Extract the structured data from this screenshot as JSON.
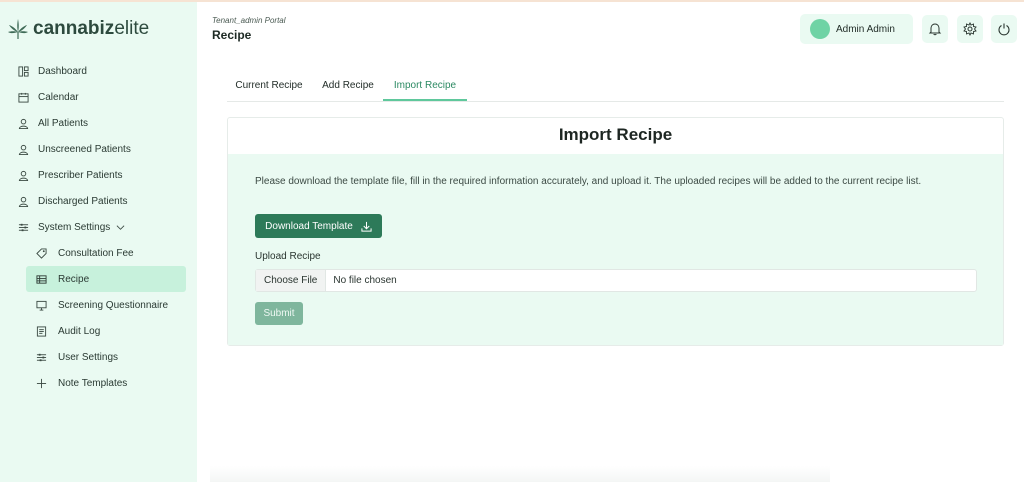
{
  "brand": {
    "name_bold": "cannabiz",
    "name_light": "elite"
  },
  "header": {
    "portal": "Tenant_admin Portal",
    "title": "Recipe"
  },
  "user": {
    "name": "Admin Admin"
  },
  "sidebar": {
    "items": [
      {
        "label": "Dashboard",
        "icon": "dashboard-icon"
      },
      {
        "label": "Calendar",
        "icon": "calendar-icon"
      },
      {
        "label": "All Patients",
        "icon": "user-icon"
      },
      {
        "label": "Unscreened Patients",
        "icon": "user-icon"
      },
      {
        "label": "Prescriber Patients",
        "icon": "user-icon"
      },
      {
        "label": "Discharged Patients",
        "icon": "user-icon"
      },
      {
        "label": "System Settings",
        "icon": "sliders-icon"
      },
      {
        "label": "Consultation Fee",
        "icon": "tag-icon"
      },
      {
        "label": "Recipe",
        "icon": "table-icon"
      },
      {
        "label": "Screening Questionnaire",
        "icon": "monitor-icon"
      },
      {
        "label": "Audit Log",
        "icon": "log-icon"
      },
      {
        "label": "User Settings",
        "icon": "sliders-icon"
      },
      {
        "label": "Note Templates",
        "icon": "plus-icon"
      }
    ]
  },
  "tabs": [
    {
      "label": "Current Recipe"
    },
    {
      "label": "Add Recipe"
    },
    {
      "label": "Import Recipe"
    }
  ],
  "card": {
    "title": "Import Recipe",
    "description": "Please download the template file, fill in the required information accurately, and upload it. The uploaded recipes will be added to the current recipe list.",
    "download_label": "Download Template",
    "upload_label": "Upload Recipe",
    "choose_file_label": "Choose File",
    "file_status": "No file chosen",
    "submit_label": "Submit"
  },
  "colors": {
    "sidebar_bg": "#eafaf2",
    "active_item": "#c7f1dc",
    "primary": "#2d7a59",
    "accent_tab": "#2c8a63",
    "submit_disabled": "#7fb69d"
  }
}
